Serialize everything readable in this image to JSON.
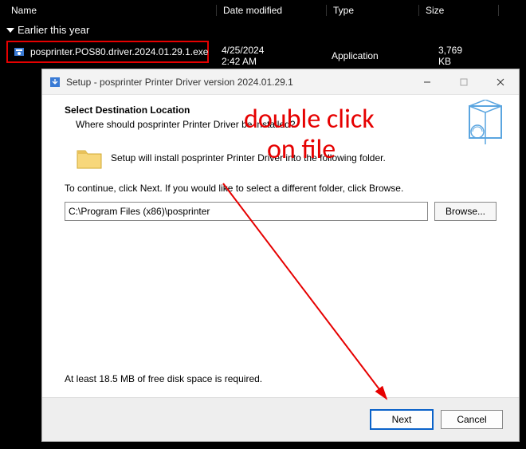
{
  "explorer": {
    "columns": {
      "name": "Name",
      "date": "Date modified",
      "type": "Type",
      "size": "Size"
    },
    "group_label": "Earlier this year",
    "file": {
      "name": "posprinter.POS80.driver.2024.01.29.1.exe",
      "date": "4/25/2024 2:42 AM",
      "type": "Application",
      "size": "3,769 KB"
    }
  },
  "annotation": {
    "line1": "double click",
    "line2": "on file"
  },
  "dialog": {
    "title": "Setup - posprinter Printer Driver version 2024.01.29.1",
    "heading": "Select Destination Location",
    "subheading": "Where should posprinter Printer Driver be installed?",
    "install_line": "Setup will install posprinter Printer Driver into the following folder.",
    "continue_line": "To continue, click Next. If you would like to select a different folder, click Browse.",
    "path": "C:\\Program Files (x86)\\posprinter",
    "browse_label": "Browse...",
    "disk_space": "At least 18.5 MB of free disk space is required.",
    "next_label": "Next",
    "cancel_label": "Cancel"
  }
}
